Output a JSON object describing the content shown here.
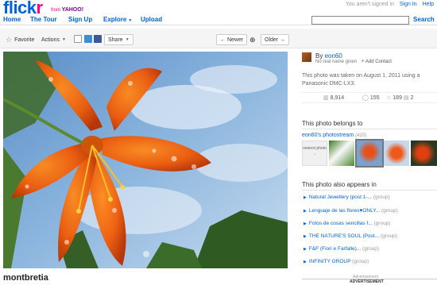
{
  "header": {
    "logo_main": "flick",
    "logo_accent": "r",
    "from_text": "from",
    "from_brand": "YAHOO!",
    "signed_out_text": "You aren't signed in",
    "sign_in": "Sign In",
    "help": "Help"
  },
  "nav": {
    "home": "Home",
    "tour": "The Tour",
    "signup": "Sign Up",
    "explore": "Explore",
    "upload": "Upload",
    "search_label": "Search",
    "search_value": ""
  },
  "toolbar": {
    "favorite": "Favorite",
    "actions": "Actions",
    "share": "Share",
    "newer": "← Newer",
    "older": "Older →"
  },
  "photo": {
    "title": "montbretia"
  },
  "owner": {
    "by": "By",
    "name": "eon60",
    "real_name": "No real name given",
    "add_contact": "Add Contact"
  },
  "details": {
    "taken_text": "This photo was taken on August 1, 2011 using a Panasonic DMC-LX3."
  },
  "stats": {
    "views": "8,914",
    "comments": "155",
    "faves": "189",
    "galleries": "2"
  },
  "belongs": {
    "heading": "This photo belongs to",
    "stream_name": "eon60's photostream",
    "stream_count": "(420)",
    "newer_label": "newest photo"
  },
  "groups": {
    "heading": "This photo also appears in",
    "suffix": "(group)",
    "items": [
      "Natural Jewellery (post 1-...",
      "Lenguaje de las flores♥ONLY...",
      "Fotos de cosas sencillas f...",
      "THE NATURE'S SOUL (Post...",
      "F&F (Fiori e Farfalle)...",
      "INFINITY GROUP"
    ]
  },
  "ad": {
    "label": "Advertisement",
    "title": "ADVERTISEMENT"
  },
  "colors": {
    "flickr_blue": "#0063dc",
    "flickr_pink": "#ff0084"
  }
}
